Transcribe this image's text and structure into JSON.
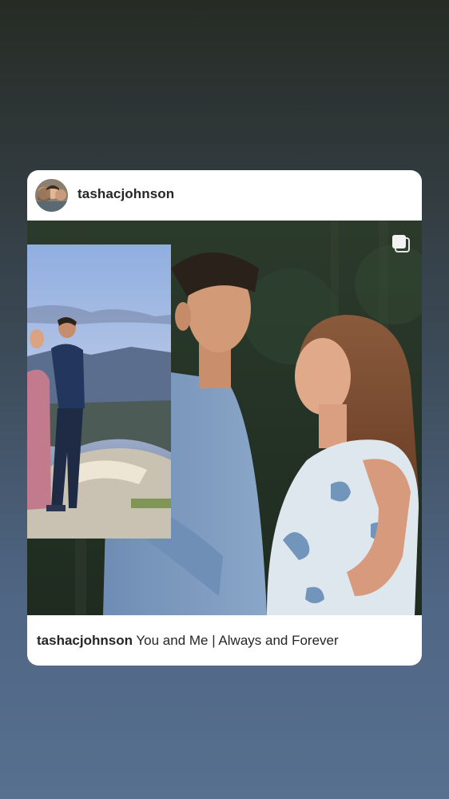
{
  "post": {
    "username": "tashacjohnson",
    "caption_user": "tashacjohnson",
    "caption_text": "You and Me | Always and Forever"
  },
  "icons": {
    "multi_photo": "carousel-icon"
  }
}
